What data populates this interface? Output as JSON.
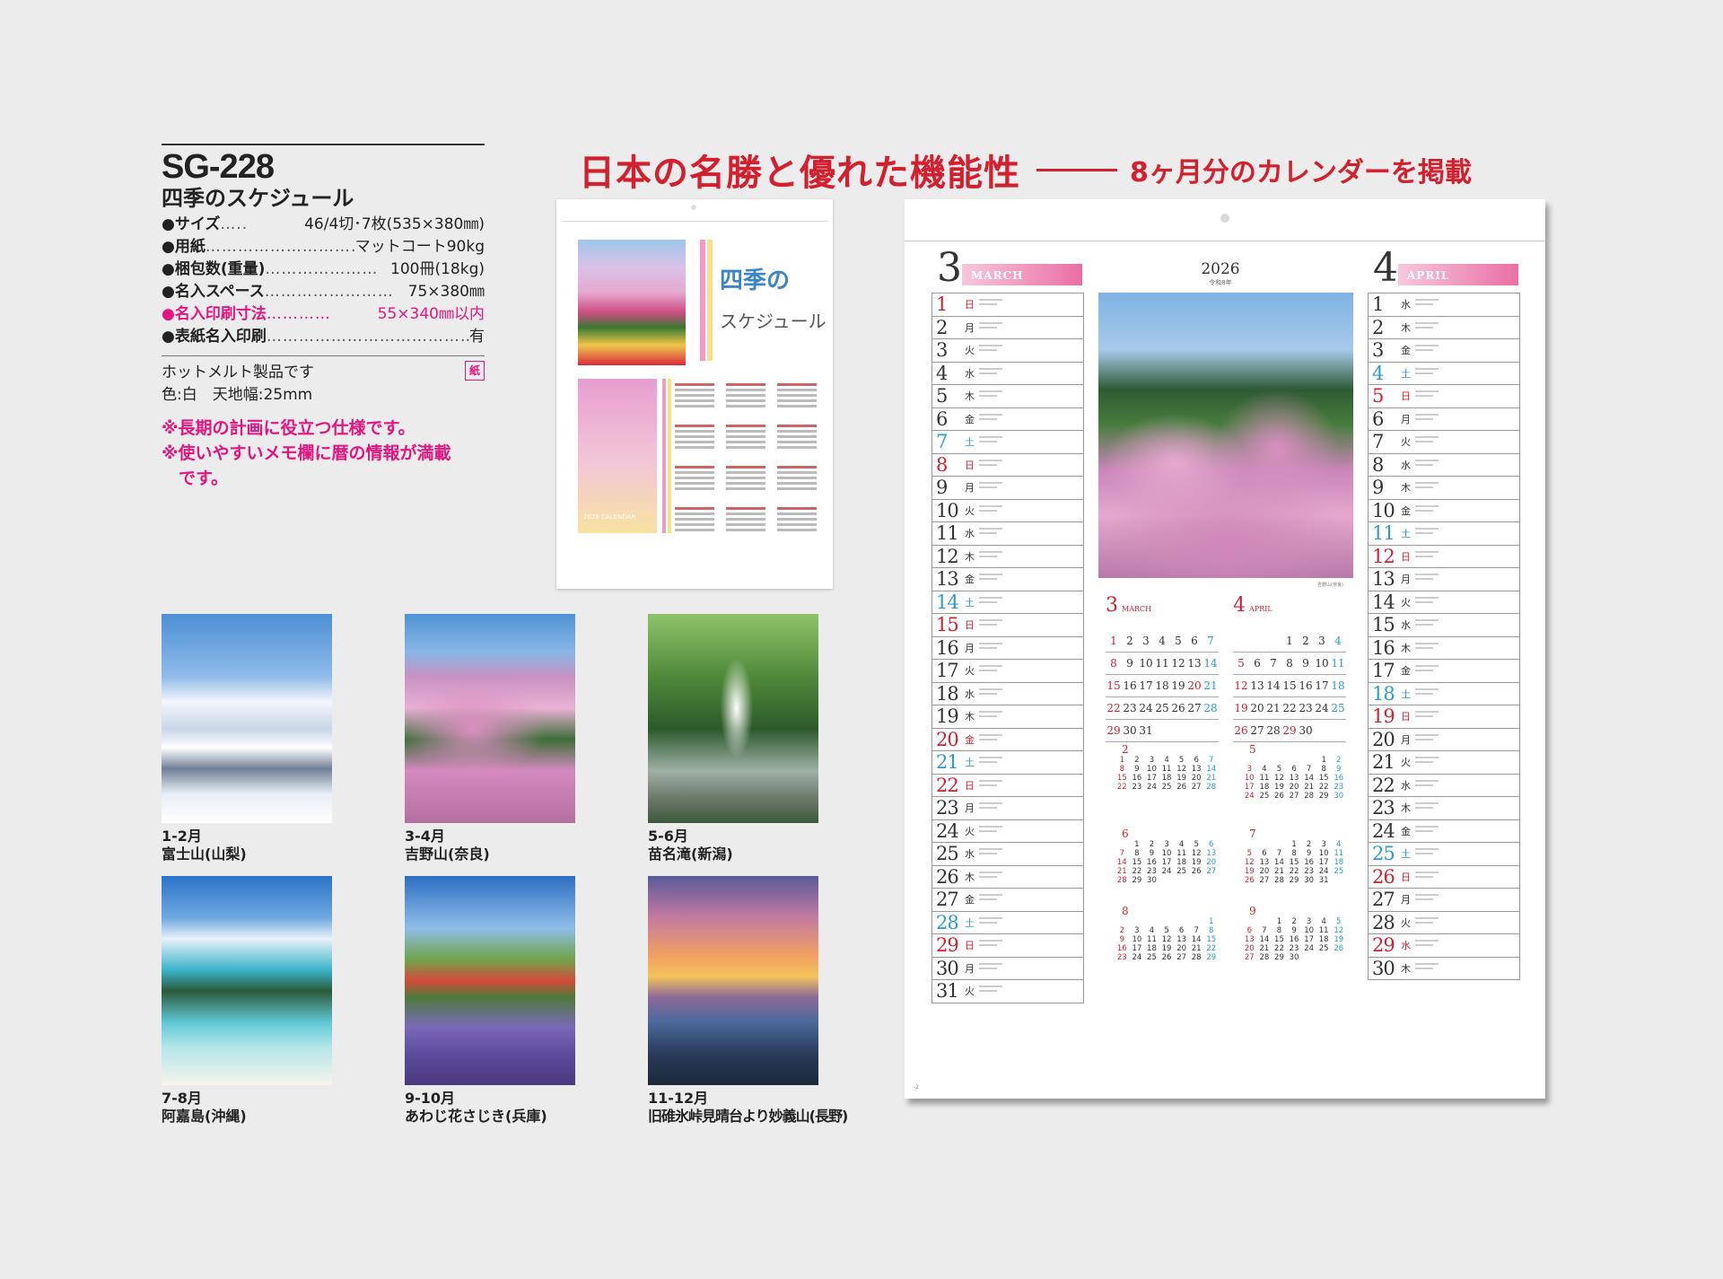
{
  "product": {
    "code": "SG-228",
    "name": "四季のスケジュール",
    "specs": [
      {
        "label": "●サイズ",
        "dots": "…..",
        "value": "46/4切･7枚(535×380㎜)",
        "highlight": false
      },
      {
        "label": "●用紙",
        "dots": "…………………………",
        "value": "マットコート90kg",
        "highlight": false
      },
      {
        "label": "●梱包数(重量)",
        "dots": "…………………",
        "value": "100冊(18kg)",
        "highlight": false
      },
      {
        "label": "●名入スペース",
        "dots": "……………………",
        "value": "75×380㎜",
        "highlight": true
      },
      {
        "label": "●名入印刷寸法",
        "dots": "…………",
        "value": "55×340㎜以内",
        "highlight": true
      },
      {
        "label": "●表紙名入印刷",
        "dots": "…………………………………",
        "value": "有",
        "highlight": false
      }
    ],
    "notes": [
      "ホットメルト製品です",
      "色:白　天地幅:25mm"
    ],
    "paper_badge": "紙",
    "features": [
      "※長期の計画に役立つ仕様です。",
      "※使いやすいメモ欄に暦の情報が満載",
      "　です。"
    ]
  },
  "headline": {
    "main": "日本の名勝と優れた機能性",
    "sub": "8ヶ月分のカレンダーを掲載"
  },
  "cover": {
    "title_line1": "四季の",
    "title_line2": "スケジュール",
    "calendar_label": "2026 CALENDAR"
  },
  "photos": [
    {
      "months": "1-2月",
      "place": "富士山(山梨)"
    },
    {
      "months": "3-4月",
      "place": "吉野山(奈良)"
    },
    {
      "months": "5-6月",
      "place": "苗名滝(新潟)"
    },
    {
      "months": "7-8月",
      "place": "阿嘉島(沖縄)"
    },
    {
      "months": "9-10月",
      "place": "あわじ花さじき(兵庫)"
    },
    {
      "months": "11-12月",
      "place": "旧碓氷峠見晴台より妙義山(長野)"
    }
  ],
  "calendar": {
    "year": "2026",
    "era": "令和8年",
    "photo_credit": "吉野山(奈良)",
    "page_mark": "-2",
    "left_month": {
      "number": "3",
      "name": "MARCH"
    },
    "right_month": {
      "number": "4",
      "name": "APRIL"
    },
    "march_days": [
      {
        "d": "1",
        "w": "日",
        "t": "sun"
      },
      {
        "d": "2",
        "w": "月",
        "t": "wk"
      },
      {
        "d": "3",
        "w": "火",
        "t": "wk"
      },
      {
        "d": "4",
        "w": "水",
        "t": "wk"
      },
      {
        "d": "5",
        "w": "木",
        "t": "wk"
      },
      {
        "d": "6",
        "w": "金",
        "t": "wk"
      },
      {
        "d": "7",
        "w": "土",
        "t": "sat"
      },
      {
        "d": "8",
        "w": "日",
        "t": "sun"
      },
      {
        "d": "9",
        "w": "月",
        "t": "wk"
      },
      {
        "d": "10",
        "w": "火",
        "t": "wk"
      },
      {
        "d": "11",
        "w": "水",
        "t": "wk"
      },
      {
        "d": "12",
        "w": "木",
        "t": "wk"
      },
      {
        "d": "13",
        "w": "金",
        "t": "wk"
      },
      {
        "d": "14",
        "w": "土",
        "t": "sat"
      },
      {
        "d": "15",
        "w": "日",
        "t": "sun"
      },
      {
        "d": "16",
        "w": "月",
        "t": "wk"
      },
      {
        "d": "17",
        "w": "火",
        "t": "wk"
      },
      {
        "d": "18",
        "w": "水",
        "t": "wk"
      },
      {
        "d": "19",
        "w": "木",
        "t": "wk"
      },
      {
        "d": "20",
        "w": "金",
        "t": "sun"
      },
      {
        "d": "21",
        "w": "土",
        "t": "sat"
      },
      {
        "d": "22",
        "w": "日",
        "t": "sun"
      },
      {
        "d": "23",
        "w": "月",
        "t": "wk"
      },
      {
        "d": "24",
        "w": "火",
        "t": "wk"
      },
      {
        "d": "25",
        "w": "水",
        "t": "wk"
      },
      {
        "d": "26",
        "w": "木",
        "t": "wk"
      },
      {
        "d": "27",
        "w": "金",
        "t": "wk"
      },
      {
        "d": "28",
        "w": "土",
        "t": "sat"
      },
      {
        "d": "29",
        "w": "日",
        "t": "sun"
      },
      {
        "d": "30",
        "w": "月",
        "t": "wk"
      },
      {
        "d": "31",
        "w": "火",
        "t": "wk"
      }
    ],
    "april_days": [
      {
        "d": "1",
        "w": "水",
        "t": "wk"
      },
      {
        "d": "2",
        "w": "木",
        "t": "wk"
      },
      {
        "d": "3",
        "w": "金",
        "t": "wk"
      },
      {
        "d": "4",
        "w": "土",
        "t": "sat"
      },
      {
        "d": "5",
        "w": "日",
        "t": "sun"
      },
      {
        "d": "6",
        "w": "月",
        "t": "wk"
      },
      {
        "d": "7",
        "w": "火",
        "t": "wk"
      },
      {
        "d": "8",
        "w": "水",
        "t": "wk"
      },
      {
        "d": "9",
        "w": "木",
        "t": "wk"
      },
      {
        "d": "10",
        "w": "金",
        "t": "wk"
      },
      {
        "d": "11",
        "w": "土",
        "t": "sat"
      },
      {
        "d": "12",
        "w": "日",
        "t": "sun"
      },
      {
        "d": "13",
        "w": "月",
        "t": "wk"
      },
      {
        "d": "14",
        "w": "火",
        "t": "wk"
      },
      {
        "d": "15",
        "w": "水",
        "t": "wk"
      },
      {
        "d": "16",
        "w": "木",
        "t": "wk"
      },
      {
        "d": "17",
        "w": "金",
        "t": "wk"
      },
      {
        "d": "18",
        "w": "土",
        "t": "sat"
      },
      {
        "d": "19",
        "w": "日",
        "t": "sun"
      },
      {
        "d": "20",
        "w": "月",
        "t": "wk"
      },
      {
        "d": "21",
        "w": "火",
        "t": "wk"
      },
      {
        "d": "22",
        "w": "水",
        "t": "wk"
      },
      {
        "d": "23",
        "w": "木",
        "t": "wk"
      },
      {
        "d": "24",
        "w": "金",
        "t": "wk"
      },
      {
        "d": "25",
        "w": "土",
        "t": "sat"
      },
      {
        "d": "26",
        "w": "日",
        "t": "sun"
      },
      {
        "d": "27",
        "w": "月",
        "t": "wk"
      },
      {
        "d": "28",
        "w": "火",
        "t": "wk"
      },
      {
        "d": "29",
        "w": "水",
        "t": "sun"
      },
      {
        "d": "30",
        "w": "木",
        "t": "wk"
      }
    ],
    "small_months": [
      {
        "number": "3",
        "name": "MARCH",
        "rows": [
          [
            {
              "v": "1",
              "t": "sun"
            },
            {
              "v": "2"
            },
            {
              "v": "3"
            },
            {
              "v": "4"
            },
            {
              "v": "5"
            },
            {
              "v": "6"
            },
            {
              "v": "7",
              "t": "sat"
            }
          ],
          [
            {
              "v": "8",
              "t": "sun"
            },
            {
              "v": "9"
            },
            {
              "v": "10"
            },
            {
              "v": "11"
            },
            {
              "v": "12"
            },
            {
              "v": "13"
            },
            {
              "v": "14",
              "t": "sat"
            }
          ],
          [
            {
              "v": "15",
              "t": "sun"
            },
            {
              "v": "16"
            },
            {
              "v": "17"
            },
            {
              "v": "18"
            },
            {
              "v": "19"
            },
            {
              "v": "20",
              "t": "sun"
            },
            {
              "v": "21",
              "t": "sat"
            }
          ],
          [
            {
              "v": "22",
              "t": "sun"
            },
            {
              "v": "23"
            },
            {
              "v": "24"
            },
            {
              "v": "25"
            },
            {
              "v": "26"
            },
            {
              "v": "27"
            },
            {
              "v": "28",
              "t": "sat"
            }
          ],
          [
            {
              "v": "29",
              "t": "sun"
            },
            {
              "v": "30"
            },
            {
              "v": "31"
            },
            {
              "v": ""
            },
            {
              "v": ""
            },
            {
              "v": ""
            },
            {
              "v": ""
            }
          ]
        ]
      },
      {
        "number": "4",
        "name": "APRIL",
        "rows": [
          [
            {
              "v": ""
            },
            {
              "v": ""
            },
            {
              "v": ""
            },
            {
              "v": "1"
            },
            {
              "v": "2"
            },
            {
              "v": "3"
            },
            {
              "v": "4",
              "t": "sat"
            }
          ],
          [
            {
              "v": "5",
              "t": "sun"
            },
            {
              "v": "6"
            },
            {
              "v": "7"
            },
            {
              "v": "8"
            },
            {
              "v": "9"
            },
            {
              "v": "10"
            },
            {
              "v": "11",
              "t": "sat"
            }
          ],
          [
            {
              "v": "12",
              "t": "sun"
            },
            {
              "v": "13"
            },
            {
              "v": "14"
            },
            {
              "v": "15"
            },
            {
              "v": "16"
            },
            {
              "v": "17"
            },
            {
              "v": "18",
              "t": "sat"
            }
          ],
          [
            {
              "v": "19",
              "t": "sun"
            },
            {
              "v": "20"
            },
            {
              "v": "21"
            },
            {
              "v": "22"
            },
            {
              "v": "23"
            },
            {
              "v": "24"
            },
            {
              "v": "25",
              "t": "sat"
            }
          ],
          [
            {
              "v": "26",
              "t": "sun"
            },
            {
              "v": "27"
            },
            {
              "v": "28"
            },
            {
              "v": "29",
              "t": "sun"
            },
            {
              "v": "30"
            },
            {
              "v": ""
            },
            {
              "v": ""
            }
          ]
        ]
      }
    ],
    "tiny_months": [
      {
        "number": "2",
        "rows": [
          [
            "1",
            "2",
            "3",
            "4",
            "5",
            "6",
            "7"
          ],
          [
            "8",
            "9",
            "10",
            "11",
            "12",
            "13",
            "14"
          ],
          [
            "15",
            "16",
            "17",
            "18",
            "19",
            "20",
            "21"
          ],
          [
            "22",
            "23",
            "24",
            "25",
            "26",
            "27",
            "28"
          ]
        ]
      },
      {
        "number": "5",
        "rows": [
          [
            "",
            "",
            "",
            "",
            "",
            "1",
            "2"
          ],
          [
            "3",
            "4",
            "5",
            "6",
            "7",
            "8",
            "9"
          ],
          [
            "10",
            "11",
            "12",
            "13",
            "14",
            "15",
            "16"
          ],
          [
            "17",
            "18",
            "19",
            "20",
            "21",
            "22",
            "23"
          ],
          [
            "24",
            "25",
            "26",
            "27",
            "28",
            "29",
            "30"
          ]
        ]
      },
      {
        "number": "6",
        "rows": [
          [
            "",
            "1",
            "2",
            "3",
            "4",
            "5",
            "6"
          ],
          [
            "7",
            "8",
            "9",
            "10",
            "11",
            "12",
            "13"
          ],
          [
            "14",
            "15",
            "16",
            "17",
            "18",
            "19",
            "20"
          ],
          [
            "21",
            "22",
            "23",
            "24",
            "25",
            "26",
            "27"
          ],
          [
            "28",
            "29",
            "30",
            "",
            "",
            "",
            ""
          ]
        ]
      },
      {
        "number": "7",
        "rows": [
          [
            "",
            "",
            "",
            "1",
            "2",
            "3",
            "4"
          ],
          [
            "5",
            "6",
            "7",
            "8",
            "9",
            "10",
            "11"
          ],
          [
            "12",
            "13",
            "14",
            "15",
            "16",
            "17",
            "18"
          ],
          [
            "19",
            "20",
            "21",
            "22",
            "23",
            "24",
            "25"
          ],
          [
            "26",
            "27",
            "28",
            "29",
            "30",
            "31",
            ""
          ]
        ]
      },
      {
        "number": "8",
        "rows": [
          [
            "",
            "",
            "",
            "",
            "",
            "",
            "1"
          ],
          [
            "2",
            "3",
            "4",
            "5",
            "6",
            "7",
            "8"
          ],
          [
            "9",
            "10",
            "11",
            "12",
            "13",
            "14",
            "15"
          ],
          [
            "16",
            "17",
            "18",
            "19",
            "20",
            "21",
            "22"
          ],
          [
            "23",
            "24",
            "25",
            "26",
            "27",
            "28",
            "29"
          ]
        ]
      },
      {
        "number": "9",
        "rows": [
          [
            "",
            "",
            "1",
            "2",
            "3",
            "4",
            "5"
          ],
          [
            "6",
            "7",
            "8",
            "9",
            "10",
            "11",
            "12"
          ],
          [
            "13",
            "14",
            "15",
            "16",
            "17",
            "18",
            "19"
          ],
          [
            "20",
            "21",
            "22",
            "23",
            "24",
            "25",
            "26"
          ],
          [
            "27",
            "28",
            "29",
            "30",
            "",
            "",
            ""
          ]
        ]
      }
    ]
  }
}
